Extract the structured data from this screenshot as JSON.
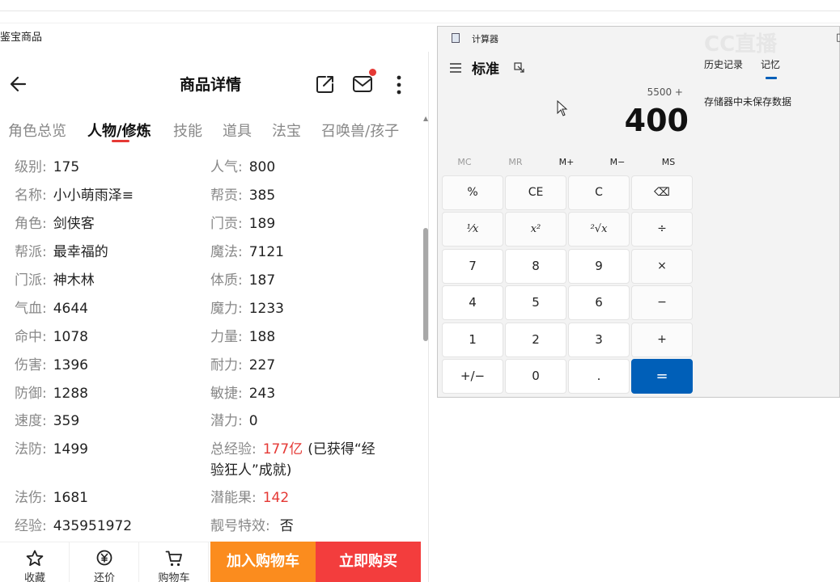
{
  "browser": {
    "tab_title": "鉴宝商品"
  },
  "mobile": {
    "nav": {
      "title": "商品详情"
    },
    "tabs": [
      "角色总览",
      "人物/修炼",
      "技能",
      "道具",
      "法宝",
      "召唤兽/孩子"
    ],
    "active_tab": "人物/修炼",
    "left_attrs": [
      {
        "k": "级别:",
        "v": "175"
      },
      {
        "k": "名称:",
        "v": "小小萌雨泽≡"
      },
      {
        "k": "角色:",
        "v": "剑侠客"
      },
      {
        "k": "帮派:",
        "v": "最幸福的"
      },
      {
        "k": "门派:",
        "v": "神木林"
      },
      {
        "k": "气血:",
        "v": "4644"
      },
      {
        "k": "命中:",
        "v": "1078"
      },
      {
        "k": "伤害:",
        "v": "1396"
      },
      {
        "k": "防御:",
        "v": "1288"
      },
      {
        "k": "速度:",
        "v": "359"
      },
      {
        "k": "法防:",
        "v": "1499"
      },
      {
        "k": "法伤:",
        "v": "1681"
      },
      {
        "k": "经验:",
        "v": "435951972"
      }
    ],
    "right_attrs": [
      {
        "k": "人气:",
        "v": "800"
      },
      {
        "k": "帮贡:",
        "v": "385"
      },
      {
        "k": "门贡:",
        "v": "189"
      },
      {
        "k": "魔法:",
        "v": "7121"
      },
      {
        "k": "体质:",
        "v": "187"
      },
      {
        "k": "魔力:",
        "v": "1233"
      },
      {
        "k": "力量:",
        "v": "188"
      },
      {
        "k": "耐力:",
        "v": "227"
      },
      {
        "k": "敏捷:",
        "v": "243"
      },
      {
        "k": "潜力:",
        "v": "0"
      }
    ],
    "total_exp": {
      "k": "总经验:",
      "v": "177亿",
      "note_line1": "(已获得“经",
      "note_line2": "验狂人”成就)"
    },
    "potential_fruit": {
      "k": "潜能果:",
      "v": "142"
    },
    "pretty_id": {
      "k": "靓号特效:",
      "v": "否"
    },
    "bottom": {
      "favorite": "收藏",
      "bargain": "还价",
      "cart": "购物车",
      "add_to_cart": "加入购物车",
      "buy_now": "立即购买"
    },
    "colors": {
      "accent_red": "#e53935",
      "cart_orange": "#fb8c1e",
      "buy_red": "#f33d3d"
    }
  },
  "calculator": {
    "title": "计算器",
    "mode": "标准",
    "expression": "5500 +",
    "display": "400",
    "memory_buttons": [
      "MC",
      "MR",
      "M+",
      "M−",
      "MS"
    ],
    "keys": [
      [
        "%",
        "CE",
        "C",
        "⌫"
      ],
      [
        "⅟x",
        "x²",
        "²√x",
        "÷"
      ],
      [
        "7",
        "8",
        "9",
        "×"
      ],
      [
        "4",
        "5",
        "6",
        "−"
      ],
      [
        "1",
        "2",
        "3",
        "+"
      ],
      [
        "+/−",
        "0",
        ".",
        "="
      ]
    ],
    "history_tab": "历史记录",
    "memory_tab": "记忆",
    "memory_empty": "存储器中未保存数据",
    "colors": {
      "equals_blue": "#005fb8"
    }
  },
  "watermark": "CC直播"
}
